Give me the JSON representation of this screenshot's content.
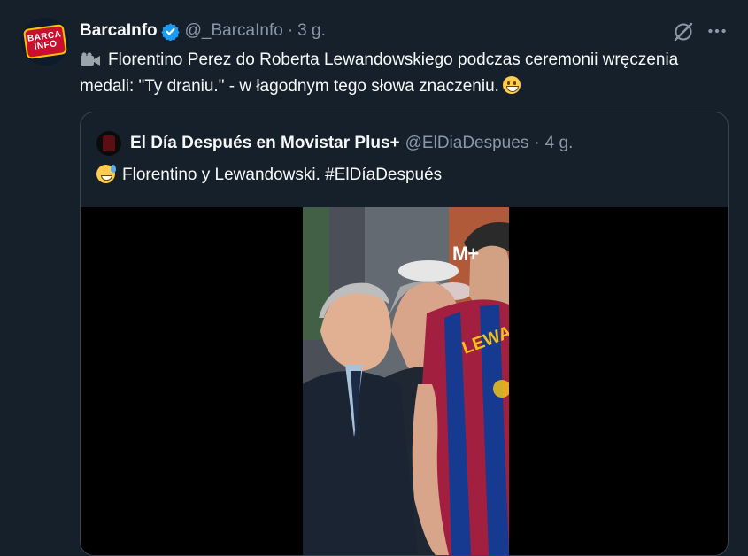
{
  "tweet": {
    "display_name": "BarcaInfo",
    "handle": "@_BarcaInfo",
    "separator": "·",
    "time": "3 g.",
    "avatar_lines": [
      "BARCA",
      "INFO"
    ],
    "text": "Florentino Perez do Roberta Lewandowskiego podczas ceremonii wręczenia medali: \"Ty draniu.\" - w łagodnym tego słowa znaczeniu."
  },
  "quote": {
    "display_name": "El Día Después en Movistar Plus+",
    "handle": "@ElDiaDespues",
    "separator": "·",
    "time": "4 g.",
    "text": "Florentino y Lewandowski. #ElDíaDespués",
    "video_brand": "M+",
    "jersey_text": "LEWAN"
  },
  "icons": {
    "verified": "verified-badge-icon",
    "camera": "video-camera-icon",
    "grok": "grok-icon",
    "more": "more-options-icon"
  },
  "colors": {
    "background": "#15202b",
    "text_primary": "#f7f9f9",
    "text_secondary": "#8b98a5",
    "border": "#38444d",
    "verified": "#1d9bf0"
  }
}
